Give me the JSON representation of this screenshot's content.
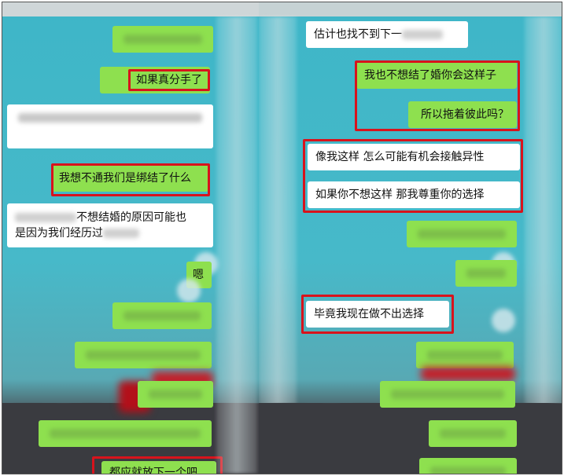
{
  "left_messages": {
    "m1": "",
    "m2": "如果真分手了",
    "m3": "",
    "m4": "我想不通我们是绑结了什么",
    "m5_line1": "不想结婚的原因可能也",
    "m5_line2": "是因为我们经历过",
    "m6": "嗯",
    "m7": "",
    "m8": "",
    "m9": "",
    "m10": "",
    "m11": "都应就放下一个吧"
  },
  "right_messages": {
    "r1": "估计也找不到下一",
    "r2": "我也不想结了婚你会这样子",
    "r3": "所以拖着彼此吗？",
    "r4": "像我这样 怎么可能有机会接触异性",
    "r5": "如果你不想这样 那我尊重你的选择",
    "r6": "",
    "r7": "",
    "r8": "毕竟我现在做不出选择",
    "r9": "",
    "r10": "",
    "r11": "",
    "r12": ""
  },
  "colors": {
    "chat_background": "#3eb6c8",
    "bubble_green": "#8ee04f",
    "bubble_white": "#ffffff",
    "highlight_red": "#d8131c",
    "ground": "#3a3b40"
  }
}
